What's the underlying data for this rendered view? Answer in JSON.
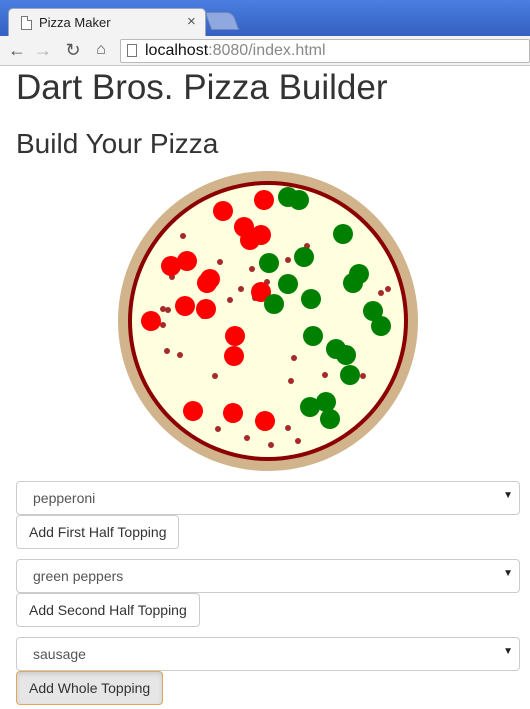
{
  "browser": {
    "tab_title": "Pizza Maker",
    "tab_close": "×",
    "url_host": "localhost",
    "url_rest": ":8080/index.html",
    "icons": {
      "back": "←",
      "forward": "→",
      "reload": "↻",
      "home": "⌂"
    }
  },
  "page": {
    "title": "Dart Bros. Pizza Builder",
    "subtitle": "Build Your Pizza"
  },
  "pizza": {
    "crust_color": "#d2b48c",
    "sauce_color": "#8b0000",
    "cheese_color": "#ffffe0",
    "pepperoni_color": "#ff0000",
    "pepper_color": "#008000",
    "sausage_color": "#a52a2a"
  },
  "controls": {
    "first_half": {
      "selected": "pepperoni",
      "button": "Add First Half Topping"
    },
    "second_half": {
      "selected": "green peppers",
      "button": "Add Second Half Topping"
    },
    "whole": {
      "selected": "sausage",
      "button": "Add Whole Topping"
    },
    "dropdown_arrow": "▼"
  }
}
